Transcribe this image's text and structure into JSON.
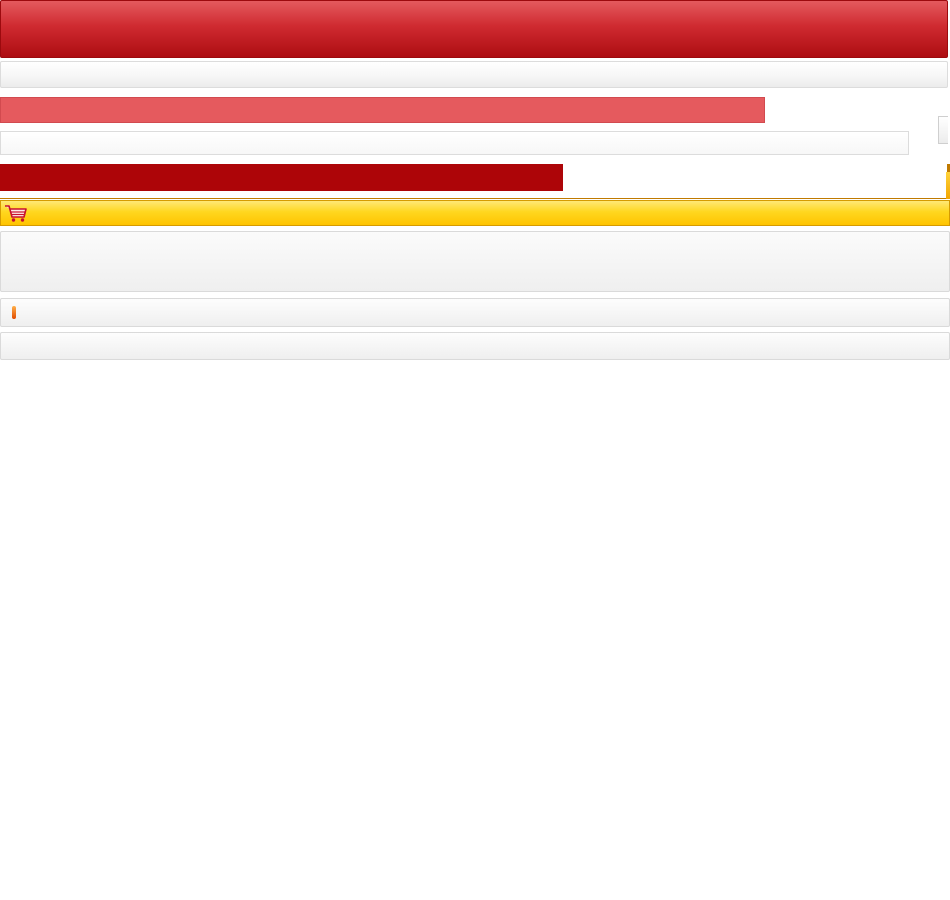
{
  "header": {
    "title": ""
  },
  "nav": {
    "text": ""
  },
  "banner": {
    "text": ""
  },
  "search": {
    "value": "",
    "placeholder": ""
  },
  "section": {
    "title": ""
  },
  "cart": {
    "label": ""
  },
  "panel": {
    "text": ""
  },
  "marker_row": {
    "text": ""
  },
  "footer": {
    "text": ""
  },
  "colors": {
    "header_red": "#cf2a30",
    "banner_red": "#e55a5e",
    "dark_red": "#ad0508",
    "cart_yellow": "#ffd71f",
    "marker_orange": "#f07000"
  },
  "icons": {
    "cart": "shopping-cart-icon",
    "marker": "orange-marker-icon"
  }
}
